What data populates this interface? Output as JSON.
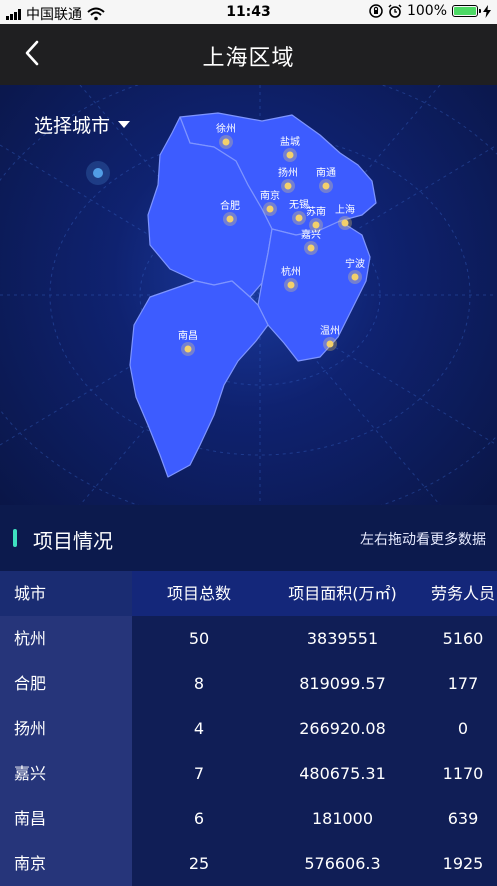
{
  "status": {
    "carrier": "中国联通",
    "time": "11:43",
    "battery": "100%",
    "battery_level": 1.0
  },
  "nav": {
    "title": "上海区域"
  },
  "map": {
    "select_label": "选择城市",
    "cities": [
      "徐州",
      "盐城",
      "扬州",
      "南通",
      "南京",
      "合肥",
      "无锡",
      "苏南",
      "上海",
      "嘉兴",
      "宁波",
      "杭州",
      "温州",
      "南昌"
    ],
    "colors": {
      "region_fill": "#3d5cff",
      "region_border": "#7e95ff",
      "dot": "#f3d06b"
    }
  },
  "section": {
    "title": "项目情况",
    "hint": "左右拖动看更多数据"
  },
  "table": {
    "headers": [
      "城市",
      "项目总数",
      "项目面积(万㎡)",
      "劳务人员"
    ],
    "rows": [
      [
        "杭州",
        "50",
        "3839551",
        "5160"
      ],
      [
        "合肥",
        "8",
        "819099.57",
        "177"
      ],
      [
        "扬州",
        "4",
        "266920.08",
        "0"
      ],
      [
        "嘉兴",
        "7",
        "480675.31",
        "1170"
      ],
      [
        "南昌",
        "6",
        "181000",
        "639"
      ],
      [
        "南京",
        "25",
        "576606.3",
        "1925"
      ]
    ]
  }
}
